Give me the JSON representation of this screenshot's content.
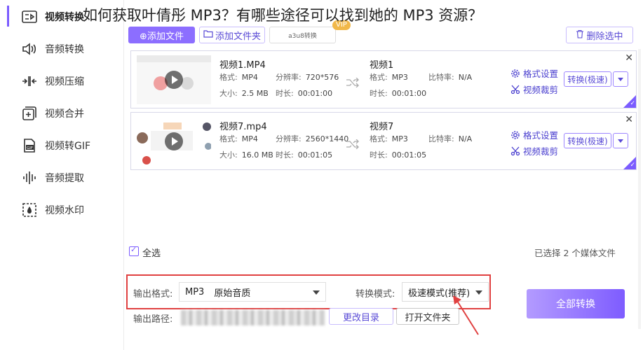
{
  "page_title": "如何获取叶倩彤 MP3？有哪些途径可以找到她的 MP3 资源？",
  "sidebar": {
    "items": [
      {
        "label": "视频转换",
        "icon": "video-convert-icon",
        "active": true
      },
      {
        "label": "音频转换",
        "icon": "audio-convert-icon"
      },
      {
        "label": "视频压缩",
        "icon": "compress-icon"
      },
      {
        "label": "视频合并",
        "icon": "merge-icon"
      },
      {
        "label": "视频转GIF",
        "icon": "gif-icon"
      },
      {
        "label": "音频提取",
        "icon": "audio-wave-icon"
      },
      {
        "label": "视频水印",
        "icon": "watermark-icon"
      }
    ]
  },
  "toolbar": {
    "add_file": "⊕添加文件",
    "add_folder": "添加文件夹",
    "middle_button": "a3u8转换",
    "vip": "VIP",
    "delete_selected": "删除选中"
  },
  "files": [
    {
      "name": "视频1.MP4",
      "format_label": "格式:",
      "format": "MP4",
      "resolution_label": "分辨率:",
      "resolution": "720*576",
      "size_label": "大小:",
      "size": "2.5 MB",
      "duration_label": "时长:",
      "duration": "00:01:00",
      "out_name": "视频1",
      "out_format": "MP3",
      "bitrate_label": "比特率:",
      "bitrate": "N/A",
      "out_duration": "00:01:00",
      "format_settings": "格式设置",
      "video_crop": "视频裁剪",
      "convert_button": "转换(极速)"
    },
    {
      "name": "视频7.mp4",
      "format_label": "格式:",
      "format": "MP4",
      "resolution_label": "分辨率:",
      "resolution": "2560*1440",
      "size_label": "大小:",
      "size": "16.0 MB",
      "duration_label": "时长:",
      "duration": "00:01:05",
      "out_name": "视频7",
      "out_format": "MP3",
      "bitrate_label": "比特率:",
      "bitrate": "N/A",
      "out_duration": "00:01:05",
      "format_settings": "格式设置",
      "video_crop": "视频裁剪",
      "convert_button": "转换(极速)"
    }
  ],
  "select_all": "全选",
  "selected_count": "已选择 2 个媒体文件",
  "output": {
    "format_label": "输出格式:",
    "format_value": "MP3",
    "format_quality": "原始音质",
    "mode_label": "转换模式:",
    "mode_value": "极速模式(推荐)",
    "path_label": "输出路径:",
    "change_dir": "更改目录",
    "open_folder": "打开文件夹",
    "convert_all": "全部转换"
  },
  "colors": {
    "accent": "#7b5cff",
    "highlight_border": "#e04040"
  }
}
